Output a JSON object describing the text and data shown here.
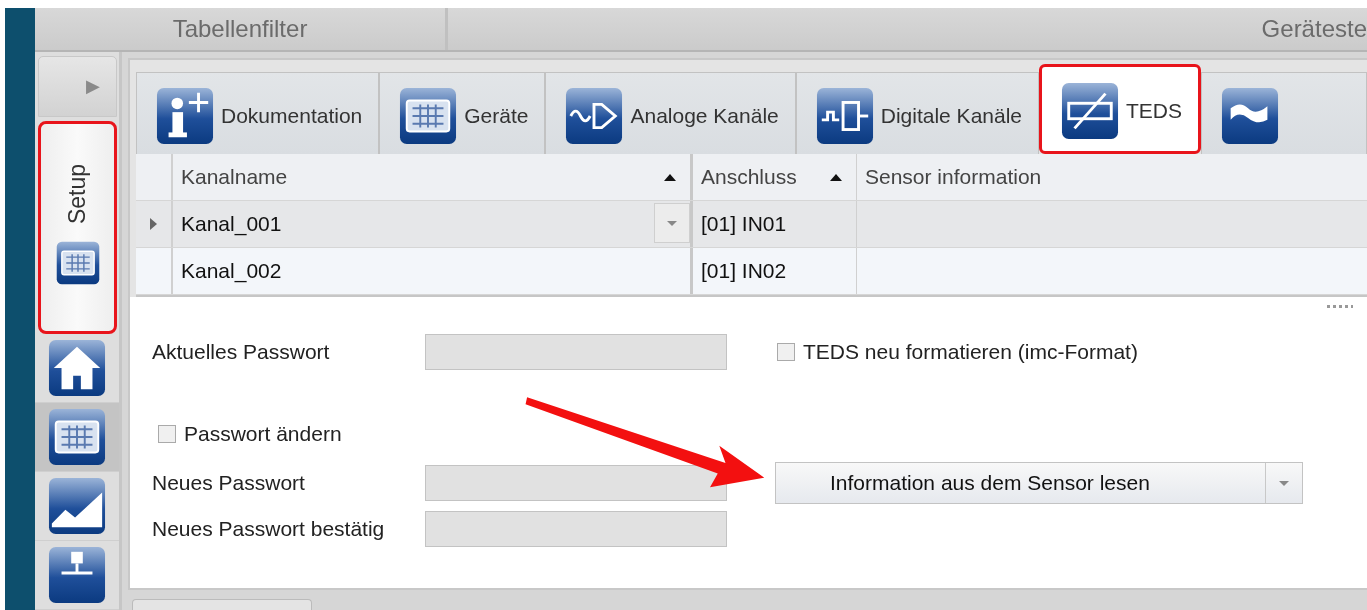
{
  "header": {
    "sections": [
      "Tabellenfilter",
      "Geräteste"
    ]
  },
  "sidebar": {
    "collapse_glyph": "▶",
    "items": [
      {
        "kind": "vertical-tab",
        "label": "Setup",
        "selected": true,
        "highlighted": true
      },
      {
        "kind": "icon",
        "selected": false
      },
      {
        "kind": "icon",
        "selected": true
      },
      {
        "kind": "icon",
        "selected": false
      },
      {
        "kind": "icon",
        "selected": false
      }
    ]
  },
  "tabs": [
    {
      "label": "Dokumentation",
      "selected": false,
      "highlighted": false
    },
    {
      "label": "Geräte",
      "selected": false,
      "highlighted": false
    },
    {
      "label": "Analoge Kanäle",
      "selected": false,
      "highlighted": false
    },
    {
      "label": "Digitale Kanäle",
      "selected": false,
      "highlighted": false
    },
    {
      "label": "TEDS",
      "selected": true,
      "highlighted": true
    },
    {
      "selected": false,
      "highlighted": false
    }
  ],
  "table": {
    "columns": [
      {
        "label": "Kanalname",
        "sorted": true
      },
      {
        "label": "Anschluss",
        "sorted": true
      },
      {
        "label": "Sensor information",
        "sorted": false
      }
    ],
    "rows": [
      {
        "selected": true,
        "cells": [
          "Kanal_001",
          "[01] IN01",
          ""
        ]
      },
      {
        "selected": false,
        "cells": [
          "Kanal_002",
          "[01] IN02",
          ""
        ]
      }
    ]
  },
  "form": {
    "current_password": {
      "label": "Aktuelles Passwort",
      "disabled": true
    },
    "reformat": {
      "label": "TEDS neu formatieren (imc-Format)",
      "checked": false
    },
    "change_password": {
      "label": "Passwort ändern",
      "checked": false
    },
    "new_password": {
      "label": "Neues Passwort",
      "disabled": true
    },
    "confirm_password": {
      "label": "Neues Passwort bestätig",
      "disabled": true
    },
    "action": {
      "label": "Information aus dem Sensor lesen"
    }
  }
}
